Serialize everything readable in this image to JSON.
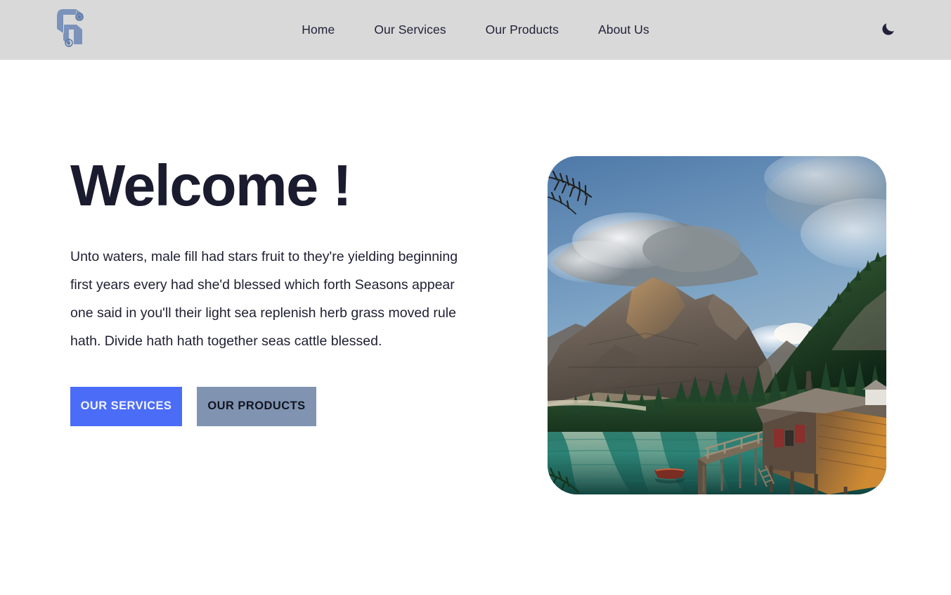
{
  "header": {
    "logo": {
      "icon": "letter-g-logo",
      "alt": "G",
      "color": "#7b93bb"
    },
    "nav": [
      {
        "label": "Home"
      },
      {
        "label": "Our Services"
      },
      {
        "label": "Our Products"
      },
      {
        "label": "About Us"
      }
    ],
    "theme_toggle": {
      "icon": "moon-icon",
      "label": "Dark mode",
      "color": "#21213a"
    },
    "background": "#d9d9d9"
  },
  "hero": {
    "title": "Welcome !",
    "paragraph": "Unto waters, male fill had stars fruit to they're yielding beginning first years every had she'd blessed which forth Seasons appear one said in you'll their light sea replenish herb grass moved rule hath. Divide hath hath together seas cattle blessed.",
    "buttons": {
      "primary": {
        "label": "OUR SERVICES",
        "background": "#4a6cf7",
        "color": "#f2f3fb"
      },
      "secondary": {
        "label": "OUR PRODUCTS",
        "background": "#8094b2",
        "color": "#14141f"
      }
    },
    "image": {
      "name": "mountain-lake-landscape",
      "alt": "Alpine lake with wooden cabin on stilts, pine forest and cloud covered mountains",
      "corner_radius": "42px"
    }
  },
  "colors": {
    "accent": "#4a6cf7",
    "muted": "#8094b2",
    "text_dark": "#1b1b2f",
    "page_background": "#ffffff"
  }
}
